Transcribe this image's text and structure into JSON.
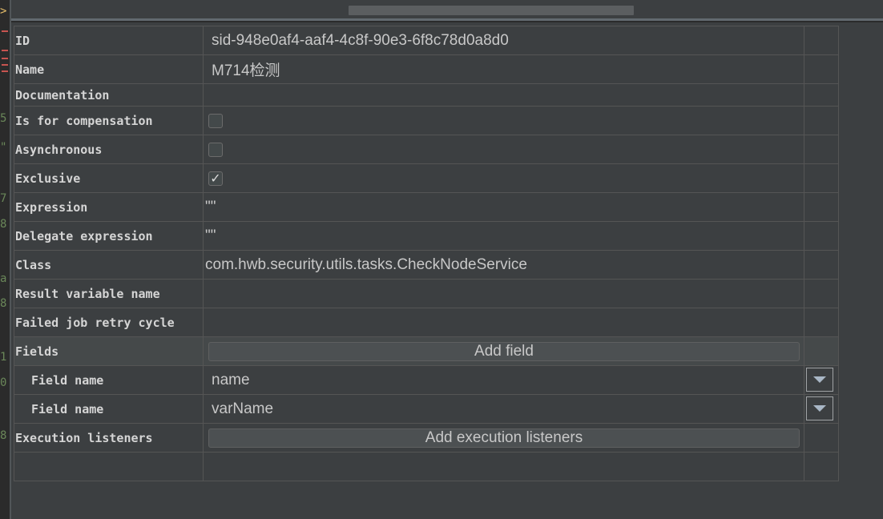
{
  "gutter": {
    "chevron": ">",
    "line_digits": [
      "5",
      "\"",
      "7",
      "8",
      "a",
      "8",
      "1",
      "0",
      "8"
    ]
  },
  "properties": {
    "id": {
      "label": "ID",
      "value": "sid-948e0af4-aaf4-4c8f-90e3-6f8c78d0a8d0"
    },
    "name": {
      "label": "Name",
      "value": "M714检测"
    },
    "documentation": {
      "label": "Documentation",
      "value": ""
    },
    "is_for_compensation": {
      "label": "Is for compensation",
      "checked": false
    },
    "asynchronous": {
      "label": "Asynchronous",
      "checked": false
    },
    "exclusive": {
      "label": "Exclusive",
      "checked": true,
      "check_glyph": "✓"
    },
    "expression": {
      "label": "Expression",
      "value": "\"\""
    },
    "delegate_expression": {
      "label": "Delegate expression",
      "value": "\"\""
    },
    "class": {
      "label": "Class",
      "value": "com.hwb.security.utils.tasks.CheckNodeService"
    },
    "result_variable_name": {
      "label": "Result variable name",
      "value": ""
    },
    "failed_job_retry_cycle": {
      "label": "Failed job retry cycle",
      "value": ""
    },
    "fields": {
      "label": "Fields",
      "button": "Add field"
    },
    "field_items": [
      {
        "label": "Field name",
        "value": "name"
      },
      {
        "label": "Field name",
        "value": "varName"
      }
    ],
    "execution_listeners": {
      "label": "Execution listeners",
      "button": "Add execution listeners"
    }
  },
  "colors": {
    "background": "#3c3f41",
    "gutter": "#2b2b2b",
    "grid": "#555555",
    "text": "#c8c8c8"
  }
}
